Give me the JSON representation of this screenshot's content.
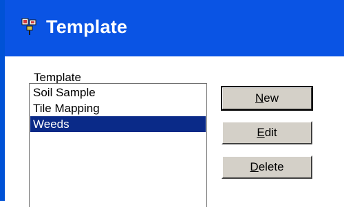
{
  "window": {
    "title": "Template",
    "icon": "app-template-icon"
  },
  "template_list": {
    "label": "Template",
    "items": [
      {
        "label": "Soil Sample",
        "selected": false
      },
      {
        "label": "Tile Mapping",
        "selected": false
      },
      {
        "label": "Weeds",
        "selected": true
      }
    ]
  },
  "buttons": {
    "new": {
      "mnemonic": "N",
      "rest": "ew"
    },
    "edit": {
      "mnemonic": "E",
      "rest": "dit"
    },
    "delete": {
      "mnemonic": "D",
      "rest": "elete"
    }
  },
  "colors": {
    "titlebar": "#0a54e4",
    "selection": "#0a2a88",
    "button_face": "#d4d0c8"
  }
}
